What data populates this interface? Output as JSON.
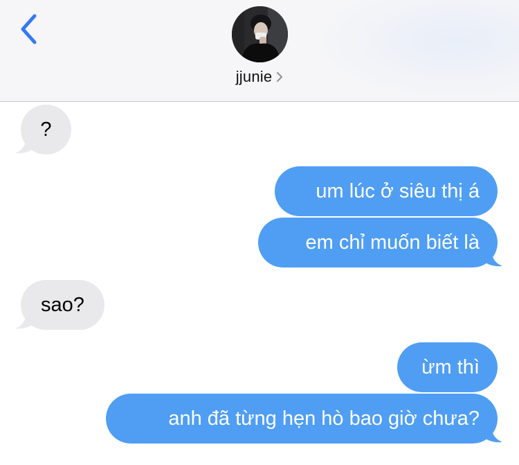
{
  "header": {
    "contact_name": "jjunie",
    "back_icon": "chevron-left-icon",
    "contact_chevron_icon": "chevron-right-icon",
    "accent_color": "#3478f6"
  },
  "messages": [
    {
      "direction": "incoming",
      "text": "?"
    },
    {
      "direction": "outgoing",
      "text": "um lúc ở siêu thị á"
    },
    {
      "direction": "outgoing",
      "text": "em chỉ muốn biết là"
    },
    {
      "direction": "incoming",
      "text": "sao?"
    },
    {
      "direction": "outgoing",
      "text": "ừm thì"
    },
    {
      "direction": "outgoing",
      "text": "anh đã từng hẹn hò bao giờ chưa?"
    }
  ],
  "colors": {
    "incoming_bubble": "#e9e9eb",
    "outgoing_bubble": "#4f9ef3",
    "header_background": "#f6f6f8"
  }
}
